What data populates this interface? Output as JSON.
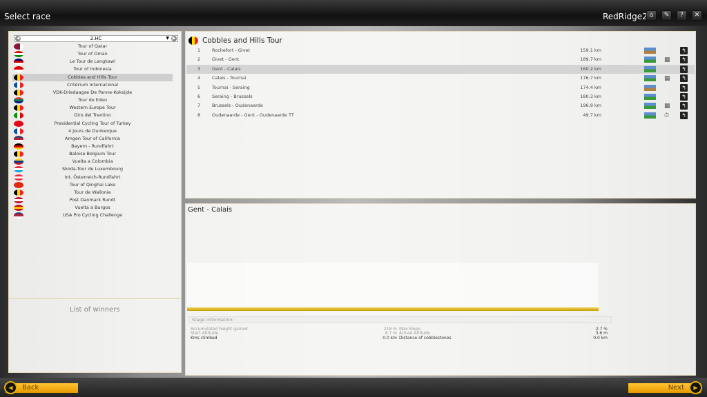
{
  "window": {
    "title": "Select race",
    "user": "RedRidge2",
    "buttons": [
      {
        "icon": "home-icon",
        "glyph": "⌂"
      },
      {
        "icon": "wrench-icon",
        "glyph": "✎"
      },
      {
        "icon": "help-icon",
        "glyph": "?"
      },
      {
        "icon": "close-icon",
        "glyph": "✕"
      }
    ]
  },
  "race_list": {
    "category": "2.HC",
    "selected": 4,
    "races": [
      {
        "name": "Tour of Qatar",
        "flag": [
          "#8a1538",
          "#8a1538",
          "#fff"
        ],
        "dir": "v"
      },
      {
        "name": "Tour of Oman",
        "flag": [
          "#d00",
          "#fff",
          "#080"
        ],
        "dir": "h"
      },
      {
        "name": "Le Tour de Langkawi",
        "flag": [
          "#010066",
          "#c00",
          "#fff"
        ],
        "dir": "h"
      },
      {
        "name": "Tour of Indonesia",
        "flag": [
          "#d00",
          "#fff"
        ],
        "dir": "h"
      },
      {
        "name": "Cobbles and Hills Tour",
        "flag": [
          "#000",
          "#fd0",
          "#e22"
        ],
        "dir": "v"
      },
      {
        "name": "Critérium International",
        "flag": [
          "#0050a4",
          "#fff",
          "#e22"
        ],
        "dir": "v"
      },
      {
        "name": "VDK-Driedaagse De Panne-Koksijde",
        "flag": [
          "#000",
          "#fd0",
          "#e22"
        ],
        "dir": "v"
      },
      {
        "name": "Tour de Eden",
        "flag": [
          "#e03c31",
          "#007a4d",
          "#001489"
        ],
        "dir": "h"
      },
      {
        "name": "Western Europe Tour",
        "flag": [
          "#000",
          "#fd0",
          "#e22"
        ],
        "dir": "v"
      },
      {
        "name": "Giro del Trentino",
        "flag": [
          "#090",
          "#fff",
          "#d00"
        ],
        "dir": "v"
      },
      {
        "name": "Presidential Cycling Tour of Turkey",
        "flag": [
          "#e30a17",
          "#e30a17"
        ],
        "dir": "v"
      },
      {
        "name": "4 Jours de Dunkerque",
        "flag": [
          "#0050a4",
          "#fff",
          "#e22"
        ],
        "dir": "v"
      },
      {
        "name": "Amgen Tour of California",
        "flag": [
          "#3c3b6e",
          "#b22234",
          "#fff"
        ],
        "dir": "h"
      },
      {
        "name": "Bayern - Rundfahrt",
        "flag": [
          "#000",
          "#d00",
          "#fc0"
        ],
        "dir": "h"
      },
      {
        "name": "Baloise Belgium Tour",
        "flag": [
          "#000",
          "#fd0",
          "#e22"
        ],
        "dir": "v"
      },
      {
        "name": "Vuelta a Colombia",
        "flag": [
          "#fcd116",
          "#003893",
          "#ce1126"
        ],
        "dir": "h"
      },
      {
        "name": "Skoda-Tour de Luxembourg",
        "flag": [
          "#ed2939",
          "#fff",
          "#00a1de"
        ],
        "dir": "h"
      },
      {
        "name": "Int. Österreich-Rundfahrt",
        "flag": [
          "#ed2939",
          "#fff",
          "#ed2939"
        ],
        "dir": "h"
      },
      {
        "name": "Tour of Qinghai Lake",
        "flag": [
          "#de2910",
          "#de2910"
        ],
        "dir": "h"
      },
      {
        "name": "Tour de Wallonie",
        "flag": [
          "#000",
          "#fd0",
          "#e22"
        ],
        "dir": "v"
      },
      {
        "name": "Post Danmark Rundt",
        "flag": [
          "#c60c30",
          "#fff",
          "#c60c30"
        ],
        "dir": "h"
      },
      {
        "name": "Vuelta a Burgos",
        "flag": [
          "#c60b1e",
          "#ffc400",
          "#c60b1e"
        ],
        "dir": "h"
      },
      {
        "name": "USA Pro Cycling Challenge",
        "flag": [
          "#3c3b6e",
          "#b22234",
          "#fff"
        ],
        "dir": "h"
      }
    ]
  },
  "winners": {
    "label": "List of winners"
  },
  "race_detail": {
    "title": "Cobbles and Hills Tour",
    "flag": [
      "#000",
      "#fd0",
      "#e22"
    ],
    "selected": 2,
    "stages": [
      {
        "n": "1",
        "name": "Rochefort - Givet",
        "km": "159.1 km",
        "terrain": "hilly",
        "extra": ""
      },
      {
        "n": "2",
        "name": "Givet - Gent",
        "km": "189.7 km",
        "terrain": "flat",
        "extra": "cobbles"
      },
      {
        "n": "3",
        "name": "Gent - Calais",
        "km": "160.2 km",
        "terrain": "flat",
        "extra": ""
      },
      {
        "n": "4",
        "name": "Calais - Tournai",
        "km": "176.7 km",
        "terrain": "flat",
        "extra": "cobbles"
      },
      {
        "n": "5",
        "name": "Tournai - Seraing",
        "km": "174.4 km",
        "terrain": "hilly",
        "extra": ""
      },
      {
        "n": "6",
        "name": "Seraing - Brussels",
        "km": "180.3 km",
        "terrain": "flat",
        "extra": ""
      },
      {
        "n": "7",
        "name": "Brussels - Oudenaarde",
        "km": "196.9 km",
        "terrain": "flat",
        "extra": "cobbles"
      },
      {
        "n": "8",
        "name": "Oudenaarde - Gent - Oudenaarde TT",
        "km": "49.7 km",
        "terrain": "flat",
        "extra": "time-trial"
      }
    ]
  },
  "stage_detail": {
    "title": "Gent - Calais",
    "info_label": "Stage Information:",
    "stats": {
      "acc_label": "Accumulated height gained",
      "acc": "218 m",
      "start_label": "Start Altitude",
      "start": "8.7 m",
      "kms_label": "Kms climbed",
      "kms": "0.0 km",
      "slope_label": "Max Slope",
      "slope": "2.7 %",
      "arrival_label": "Arrival Altitude",
      "arrival": "3.6 m",
      "cobbles_label": "Distance of cobblestones",
      "cobbles": "0.0 km"
    }
  },
  "footer": {
    "back": "Back",
    "next": "Next"
  }
}
